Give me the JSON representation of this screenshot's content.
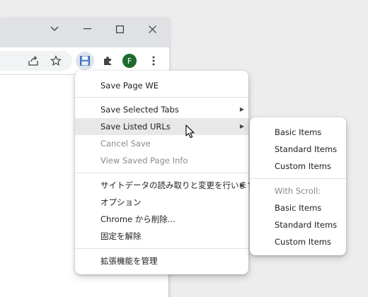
{
  "window": {
    "minimize_icon": "chevron-down-icon",
    "controls": [
      "minimize",
      "maximize",
      "close"
    ]
  },
  "toolbar": {
    "icons": [
      "share-icon",
      "star-icon",
      "save-page-we-icon",
      "extensions-puzzle-icon",
      "profile-avatar",
      "more-vert-icon"
    ],
    "avatar_letter": "F",
    "avatar_color": "#1e6b2e"
  },
  "context_menu": {
    "items": [
      {
        "label": "Save Page WE"
      },
      {
        "label": "Save Selected Tabs",
        "submenu": true
      },
      {
        "label": "Save Listed URLs",
        "submenu": true,
        "hovered": true
      },
      {
        "label": "Cancel Save",
        "disabled": true
      },
      {
        "label": "View Saved Page Info",
        "disabled": true
      },
      {
        "label": "サイトデータの読み取りと変更を行います",
        "submenu": true
      },
      {
        "label": "オプション"
      },
      {
        "label": "Chrome から削除..."
      },
      {
        "label": "固定を解除"
      },
      {
        "label": "拡張機能を管理"
      }
    ]
  },
  "submenu": {
    "items": [
      {
        "label": "Basic Items"
      },
      {
        "label": "Standard Items"
      },
      {
        "label": "Custom Items"
      },
      {
        "label": "With Scroll:",
        "disabled": true
      },
      {
        "label": "Basic Items"
      },
      {
        "label": "Standard Items"
      },
      {
        "label": "Custom Items"
      }
    ]
  },
  "colors": {
    "menu_hover": "#e8e8e9",
    "disabled_text": "#8a8a8a",
    "titlebar": "#dfe1e5"
  }
}
